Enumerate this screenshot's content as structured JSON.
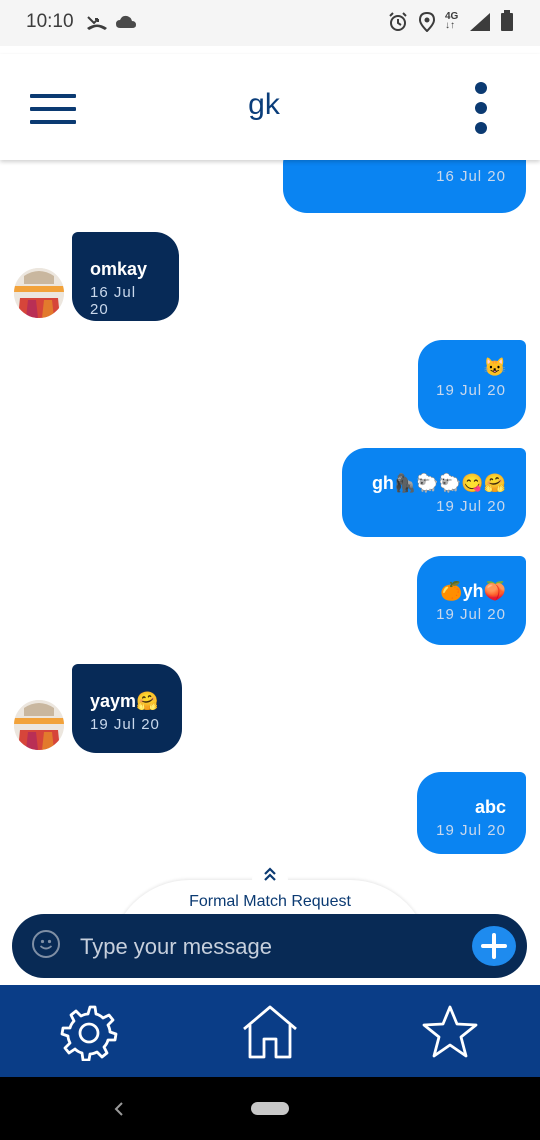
{
  "status_bar": {
    "time": "10:10",
    "network": "4G"
  },
  "header": {
    "title": "gk"
  },
  "messages": [
    {
      "direction": "out",
      "text": "",
      "time": "16 Jul 20"
    },
    {
      "direction": "in",
      "text": "omkay",
      "time": "16 Jul 20"
    },
    {
      "direction": "out",
      "text": "😺",
      "time": "19 Jul 20"
    },
    {
      "direction": "out",
      "text": "gh🦍🐑🐑😋🤗",
      "time": "19 Jul 20"
    },
    {
      "direction": "out",
      "text": "🍊yh🍑",
      "time": "19 Jul 20"
    },
    {
      "direction": "in",
      "text": "yaym🤗",
      "time": "19 Jul 20"
    },
    {
      "direction": "out",
      "text": "abc",
      "time": "19 Jul 20"
    }
  ],
  "formal_match": {
    "label": "Formal Match Request"
  },
  "composer": {
    "placeholder": "Type your message",
    "value": ""
  },
  "bottom_nav": [
    "settings-icon",
    "home-icon",
    "star-icon"
  ],
  "colors": {
    "primary": "#0a3d87",
    "outgoing": "#0a84f2",
    "incoming": "#072a57"
  }
}
